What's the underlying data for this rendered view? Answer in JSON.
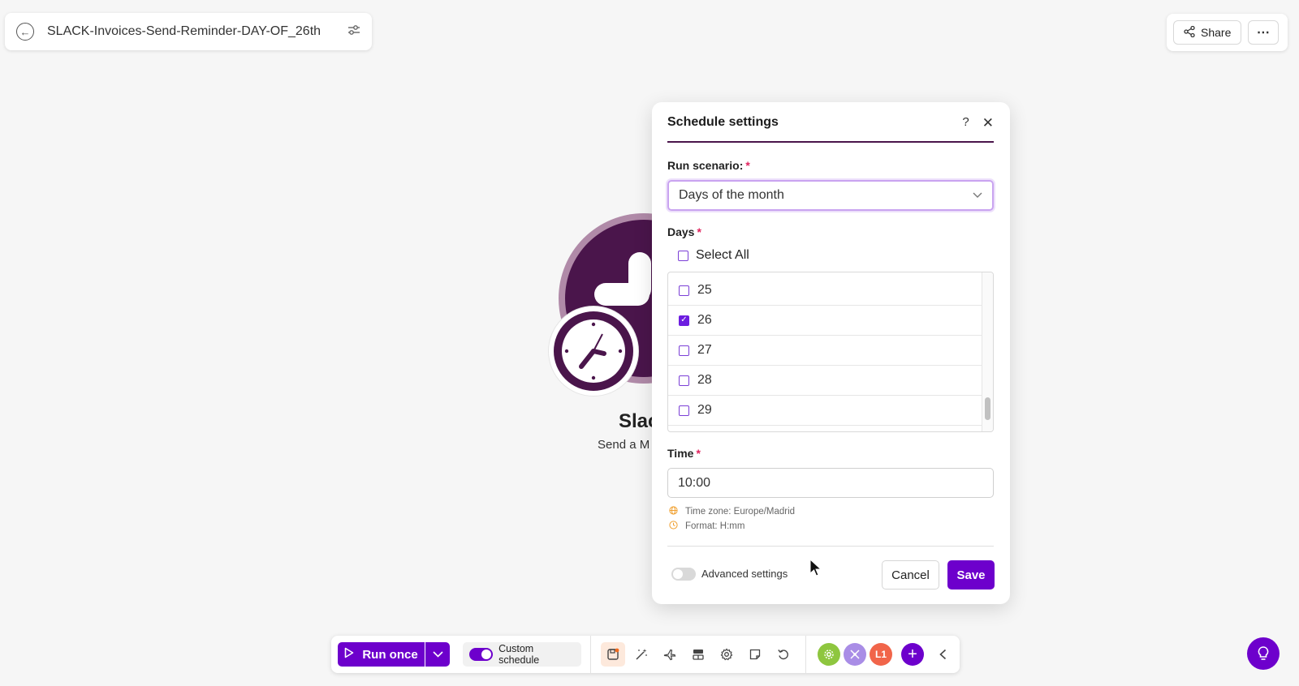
{
  "header": {
    "scenario_title": "SLACK-Invoices-Send-Reminder-DAY-OF_26th",
    "share_label": "Share",
    "more_label": "⋯"
  },
  "module": {
    "label": "Slac",
    "sublabel": "Send a M"
  },
  "dialog": {
    "title": "Schedule settings",
    "help_label": "?",
    "close_label": "✕",
    "run_scenario_label": "Run scenario:",
    "required_marker": "*",
    "run_scenario_value": "Days of the month",
    "days_label": "Days",
    "select_all_label": "Select All",
    "days": [
      {
        "label": "25",
        "checked": false
      },
      {
        "label": "26",
        "checked": true
      },
      {
        "label": "27",
        "checked": false
      },
      {
        "label": "28",
        "checked": false
      },
      {
        "label": "29",
        "checked": false
      }
    ],
    "time_label": "Time",
    "time_value": "10:00",
    "timezone_hint": "Time zone: Europe/Madrid",
    "format_hint": "Format: H:mm",
    "advanced_label": "Advanced settings",
    "advanced_enabled": false,
    "cancel_label": "Cancel",
    "save_label": "Save"
  },
  "toolbar": {
    "run_once_label": "Run once",
    "custom_schedule_label": "Custom schedule",
    "custom_schedule_enabled": true,
    "badge_1_label": "L1"
  },
  "colors": {
    "accent": "#6d00cc",
    "slack_aubergine": "#4a154b",
    "required": "#e0245e",
    "active_tool": "#fde9dc"
  }
}
